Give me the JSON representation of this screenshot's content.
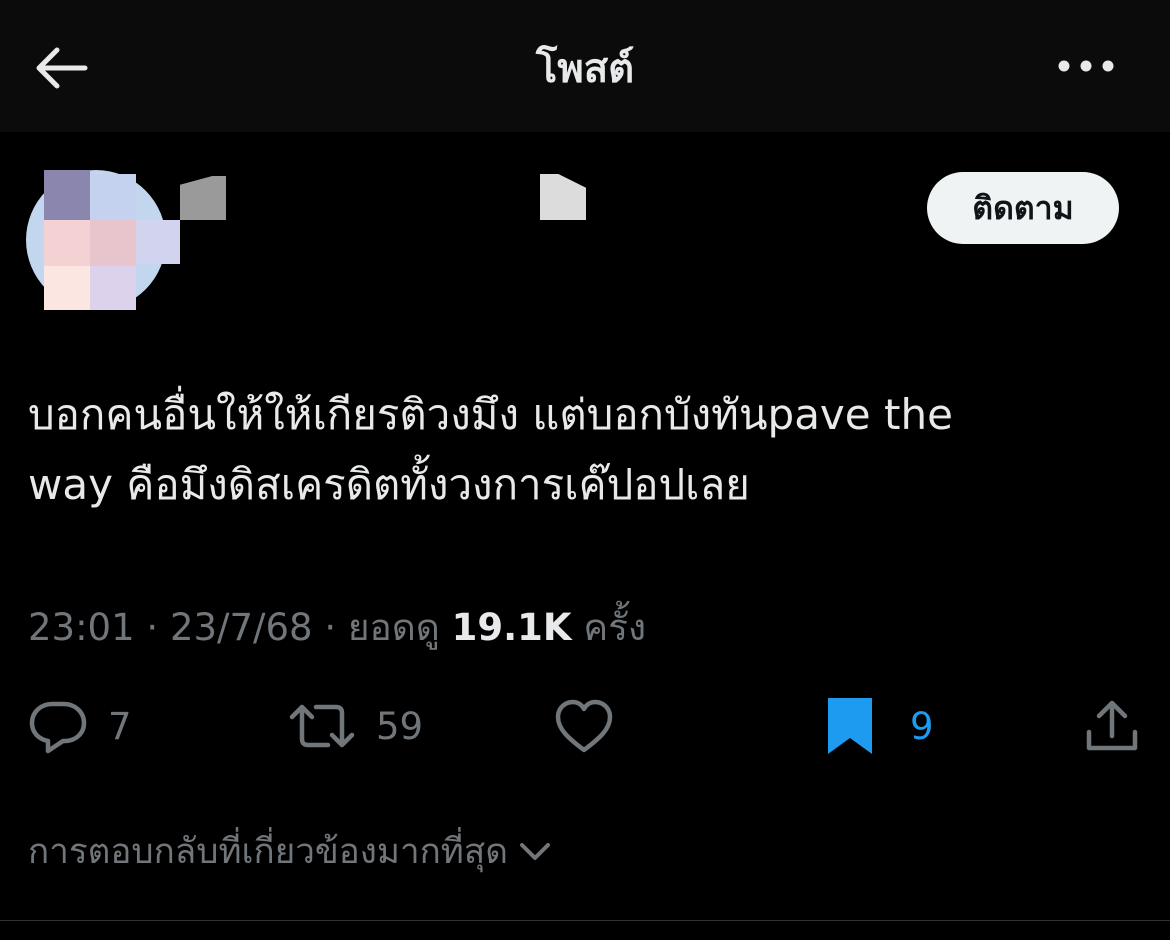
{
  "header": {
    "title": "โพสต์",
    "back_icon": "arrow-left-icon",
    "more_icon": "more-horizontal-icon"
  },
  "author": {
    "follow_label": "ติดตาม"
  },
  "tweet": {
    "text_line1": "บอกคนอื่นให้ให้เกียรติวงมึง แต่บอกบังทันpave the",
    "text_line2": "way คือมึงดิสเครดิตทั้งวงการเค๊ปอปเลย",
    "time": "23:01",
    "date": "23/7/68",
    "separator": "·",
    "views_label": "ยอดดู",
    "views_count": "19.1K",
    "views_suffix": "ครั้ง"
  },
  "actions": {
    "reply_count": "7",
    "repost_count": "59",
    "like_count": "",
    "bookmark_count": "9"
  },
  "replies": {
    "sort_label": "การตอบกลับที่เกี่ยวข้องมากที่สุด"
  },
  "colors": {
    "background": "#000000",
    "text": "#e7e9ea",
    "muted": "#71767b",
    "accent": "#1d9bf0",
    "follow_bg": "#eff3f4"
  }
}
